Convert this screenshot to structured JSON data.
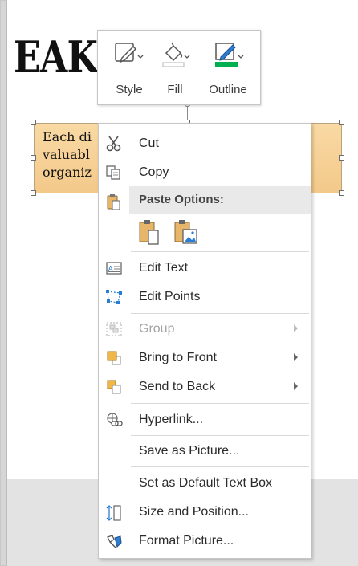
{
  "slide": {
    "title_fragment": "EAKDO",
    "textbox_fragment": "Each di\nvaluabl\norganiz"
  },
  "mini_toolbar": {
    "buttons": [
      {
        "label": "Style",
        "icon": "shape-style-icon"
      },
      {
        "label": "Fill",
        "icon": "paint-bucket-icon"
      },
      {
        "label": "Outline",
        "icon": "pen-outline-icon"
      }
    ],
    "colors": {
      "fill_bar": "#ffffff",
      "outline_bar": "#00b050"
    }
  },
  "context_menu": {
    "items": [
      {
        "label": "Cut",
        "icon": "scissors-icon",
        "shortcut_letter": "t"
      },
      {
        "label": "Copy",
        "icon": "copy-icon",
        "shortcut_letter": "C"
      },
      {
        "label": "Paste Options:",
        "icon": "paste-icon"
      },
      {
        "label": "Edit Text",
        "icon": "edit-text-icon"
      },
      {
        "label": "Edit Points",
        "icon": "edit-points-icon"
      },
      {
        "label": "Group",
        "icon": "group-icon",
        "disabled": true,
        "submenu": true
      },
      {
        "label": "Bring to Front",
        "icon": "bring-to-front-icon",
        "submenu": true
      },
      {
        "label": "Send to Back",
        "icon": "send-to-back-icon",
        "submenu": true
      },
      {
        "label": "Hyperlink...",
        "icon": "hyperlink-icon"
      },
      {
        "label": "Save as Picture...",
        "icon": ""
      },
      {
        "label": "Set as Default Text Box",
        "icon": ""
      },
      {
        "label": "Size and Position...",
        "icon": "size-position-icon"
      },
      {
        "label": "Format Picture...",
        "icon": "format-picture-icon"
      }
    ],
    "paste_buttons": [
      {
        "icon": "paste-keep-source-icon"
      },
      {
        "icon": "paste-picture-icon"
      }
    ]
  }
}
